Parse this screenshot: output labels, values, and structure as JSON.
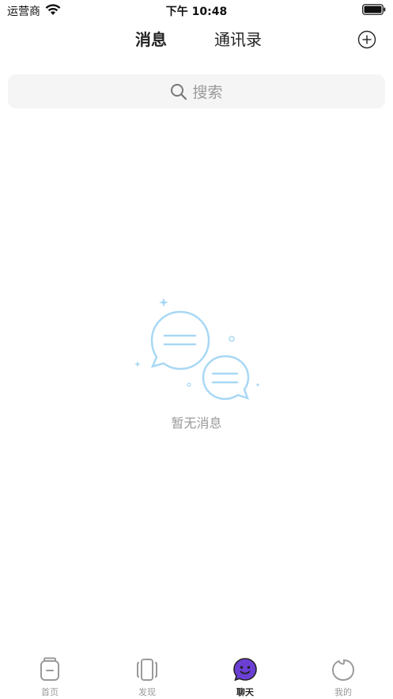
{
  "status_bar": {
    "carrier": "运营商",
    "time": "下午 10:48"
  },
  "header": {
    "tabs": [
      {
        "label": "消息",
        "active": true
      },
      {
        "label": "通讯录",
        "active": false
      }
    ],
    "add_icon": "plus-circle-icon"
  },
  "search": {
    "placeholder": "搜索",
    "icon": "search-icon"
  },
  "empty_state": {
    "text": "暂无消息",
    "icon": "chat-bubbles-illustration",
    "accent_color": "#a8d8f5"
  },
  "tabbar": {
    "items": [
      {
        "label": "首页",
        "icon": "home-icon",
        "active": false
      },
      {
        "label": "发现",
        "icon": "discover-icon",
        "active": false
      },
      {
        "label": "聊天",
        "icon": "chat-icon",
        "active": true
      },
      {
        "label": "我的",
        "icon": "profile-icon",
        "active": false
      }
    ],
    "active_color": "#6b3fd4",
    "inactive_color": "#9a9a9a"
  }
}
